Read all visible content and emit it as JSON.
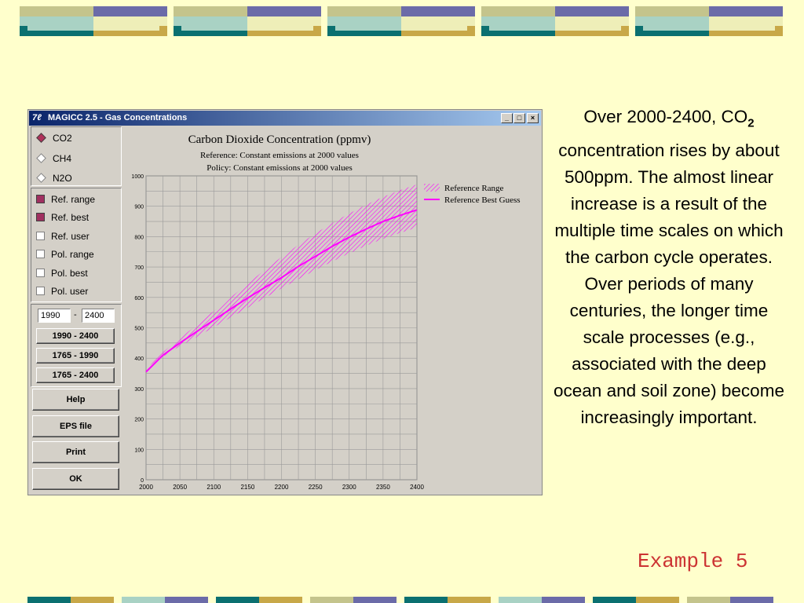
{
  "window": {
    "icon_text": "7ℓ",
    "title": "MAGICC 2.5 - Gas Concentrations",
    "controls": [
      "_",
      "□",
      "×"
    ]
  },
  "gases": [
    {
      "label": "CO2",
      "selected": true
    },
    {
      "label": "CH4",
      "selected": false
    },
    {
      "label": "N2O",
      "selected": false
    }
  ],
  "curves": [
    {
      "label": "Ref. range",
      "checked": true
    },
    {
      "label": "Ref. best",
      "checked": true
    },
    {
      "label": "Ref. user",
      "checked": false
    },
    {
      "label": "Pol. range",
      "checked": false
    },
    {
      "label": "Pol. best",
      "checked": false
    },
    {
      "label": "Pol. user",
      "checked": false
    }
  ],
  "range": {
    "start": "1990",
    "separator": "-",
    "end": "2400"
  },
  "period_buttons": [
    "1990 - 2400",
    "1765 - 1990",
    "1765 - 2400"
  ],
  "action_buttons": [
    "Help",
    "EPS file",
    "Print",
    "OK"
  ],
  "chart_data": {
    "type": "line",
    "title": "Carbon Dioxide Concentration (ppmv)",
    "subtitle_1": "Reference: Constant emissions at 2000 values",
    "subtitle_2": "Policy: Constant emissions at 2000 values",
    "xlim": [
      2000,
      2400
    ],
    "ylim": [
      0,
      1000
    ],
    "x_ticks": [
      "2000",
      "2050",
      "2100",
      "2150",
      "2200",
      "2250",
      "2300",
      "2350",
      "2400"
    ],
    "y_ticks": [
      "0",
      "100",
      "200",
      "300",
      "400",
      "500",
      "600",
      "700",
      "800",
      "900",
      "1000"
    ],
    "grid": true,
    "legend_position": "top-right",
    "accent_color": "#ff00ff",
    "series": [
      {
        "name": "Reference Range",
        "kind": "band",
        "x": [
          2000,
          2025,
          2050,
          2075,
          2100,
          2125,
          2150,
          2175,
          2200,
          2225,
          2250,
          2275,
          2300,
          2325,
          2350,
          2375,
          2400
        ],
        "low": [
          368,
          405,
          440,
          470,
          502,
          534,
          566,
          598,
          630,
          660,
          690,
          718,
          745,
          770,
          793,
          812,
          830
        ],
        "high": [
          372,
          420,
          465,
          510,
          555,
          600,
          645,
          690,
          733,
          773,
          810,
          845,
          876,
          905,
          931,
          953,
          972
        ]
      },
      {
        "name": "Reference Best Guess",
        "kind": "line",
        "x": [
          2000,
          2025,
          2050,
          2075,
          2100,
          2125,
          2150,
          2175,
          2200,
          2225,
          2250,
          2275,
          2300,
          2325,
          2350,
          2375,
          2400
        ],
        "values": [
          355,
          410,
          450,
          488,
          525,
          562,
          598,
          632,
          665,
          702,
          735,
          768,
          798,
          825,
          850,
          870,
          888
        ]
      }
    ]
  },
  "description": {
    "line_1_prefix": "Over 2000-2400, CO",
    "line_1_sub": "2",
    "body": "concentration rises by about 500ppm. The almost linear increase is a result of the multiple time scales on which the carbon cycle operates. Over periods of many centuries, the longer time scale processes (e.g., associated with the deep ocean and soil zone) become increasingly important."
  },
  "footer_label": "Example 5",
  "colors": {
    "background": "#ffffcc",
    "titlebar": "#0a246a",
    "footer_text": "#cc3333",
    "band": "#ff00ff"
  }
}
